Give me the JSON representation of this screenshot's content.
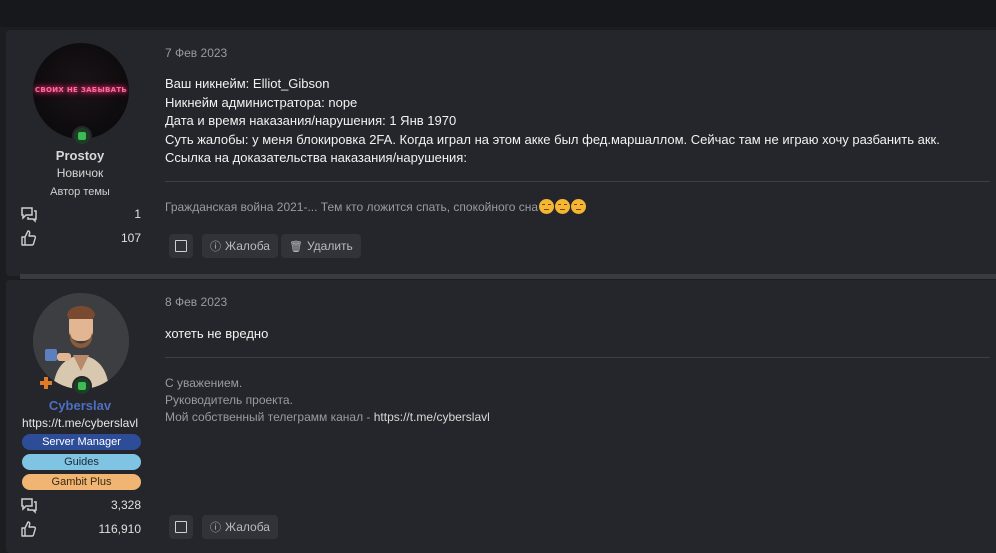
{
  "posts": [
    {
      "user": {
        "name": "Prostoy",
        "title": "Новичок",
        "author_badge": "Автор темы",
        "avatar_text": "СВОИХ НЕ ЗАБЫВАТЬ",
        "messages": "1",
        "reactions": "107"
      },
      "date": "7 Фев 2023",
      "body": [
        "Ваш никнейм: Elliot_Gibson",
        "Никнейм администратора: nope",
        "Дата и время наказания/нарушения: 1 Янв 1970",
        "Суть жалобы: у меня блокировка 2FA. Когда играл на этом акке был фед.маршаллом. Сейчас там не играю хочу разбанить акк.",
        "Ссылка на доказательства наказания/нарушения:"
      ],
      "signature": "Гражданская война 2021-... Тем кто ложится спать, спокойного сна",
      "actions": {
        "report": "Жалоба",
        "delete": "Удалить"
      }
    },
    {
      "user": {
        "name": "Cyberslav",
        "title": "https://t.me/cyberslavl",
        "roles": [
          "Server Manager",
          "Guides",
          "Gambit Plus"
        ],
        "messages": "3,328",
        "reactions": "116,910"
      },
      "date": "8 Фев 2023",
      "body": [
        "хотеть не вредно"
      ],
      "signature": {
        "line1": "С уважением.",
        "line2": "Руководитель проекта.",
        "line3_prefix": "Мой собственный телеграмм канал - ",
        "line3_link": "https://t.me/cyberslavl"
      },
      "actions": {
        "report": "Жалоба"
      }
    }
  ],
  "icons": {
    "messages": "messages-icon",
    "reactions": "thumbs-up-icon",
    "report": "info-circle-icon",
    "delete": "trash-icon",
    "select": "checkbox-icon"
  },
  "colors": {
    "background": "#1c1d21",
    "post_bg": "#25262b",
    "staff_name": "#4d6fbf",
    "server_manager": "#2e4d99",
    "guides": "#7fc4e3",
    "gambit_plus": "#f0b572"
  }
}
